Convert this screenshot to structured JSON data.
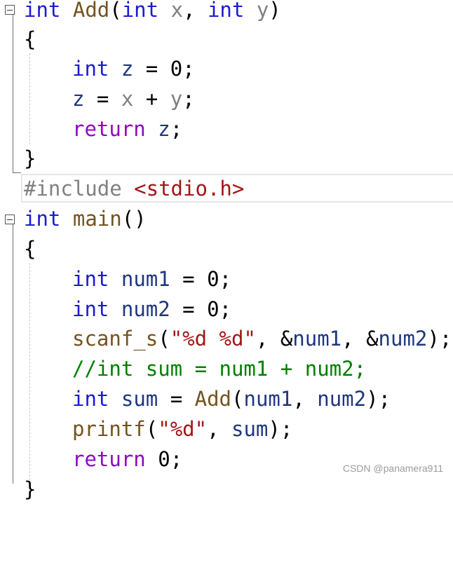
{
  "editor": {
    "fold_markers": [
      "collapse",
      "collapse"
    ],
    "lines": {
      "l1": {
        "kw1": "int",
        "fn": "Add",
        "p1": "(",
        "kw2": "int",
        "x": "x",
        "comma": ", ",
        "kw3": "int",
        "y": "y",
        "p2": ")"
      },
      "l2": {
        "brace": "{"
      },
      "l3": {
        "kw": "int",
        "var": "z",
        "eq": " = ",
        "num": "0",
        "semi": ";"
      },
      "l4": {
        "var": "z",
        "eq": " = ",
        "x": "x",
        "plus": " + ",
        "y": "y",
        "semi": ";"
      },
      "l5": {
        "ctl": "return",
        "var": "z",
        "semi": ";"
      },
      "l6": {
        "brace": "}"
      },
      "l7": {
        "pp": "#include",
        "hdr": "<stdio.h>"
      },
      "l8": {
        "kw": "int",
        "fn": "main",
        "parens": "()"
      },
      "l9": {
        "brace": "{"
      },
      "l10": {
        "kw": "int",
        "var": "num1",
        "eq": " = ",
        "num": "0",
        "semi": ";"
      },
      "l11": {
        "kw": "int",
        "var": "num2",
        "eq": " = ",
        "num": "0",
        "semi": ";"
      },
      "l12": {
        "fn": "scanf_s",
        "p1": "(",
        "str": "\"%d %d\"",
        "c1": ", ",
        "amp1": "&",
        "v1": "num1",
        "c2": ", ",
        "amp2": "&",
        "v2": "num2",
        "p2": ");"
      },
      "l13": {
        "cmt": "//int sum = num1 + num2;"
      },
      "l14": {
        "kw": "int",
        "var": "sum",
        "eq": " = ",
        "fn": "Add",
        "p1": "(",
        "v1": "num1",
        "c1": ", ",
        "v2": "num2",
        "p2": ");"
      },
      "l15": {
        "fn": "printf",
        "p1": "(",
        "str": "\"%d\"",
        "c1": ", ",
        "v1": "sum",
        "p2": ");"
      },
      "l16": {
        "ctl": "return",
        "num": "0",
        "semi": ";"
      },
      "l17": {
        "brace": "}"
      }
    }
  },
  "watermark": "CSDN @panamera911"
}
